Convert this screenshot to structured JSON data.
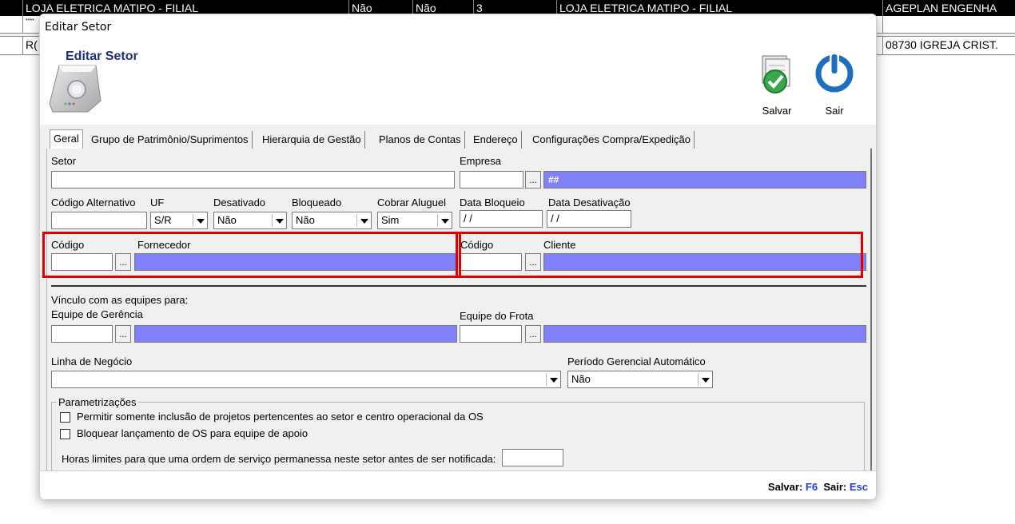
{
  "background": {
    "row0": [
      "LOJA ELETRICA MATIPO - FILIAL",
      "Não",
      "Não",
      "3",
      "LOJA ELETRICA MATIPO - FILIAL",
      "AGEPLAN ENGENHA"
    ],
    "row1_marker": "****",
    "row2": [
      "R(",
      "08730 IGREJA CRIST."
    ]
  },
  "window": {
    "title": "Editar Setor"
  },
  "header": {
    "title": "Editar Setor",
    "save_label": "Salvar",
    "exit_label": "Sair"
  },
  "tabs": [
    {
      "label": "Geral"
    },
    {
      "label": "Grupo de Patrimônio/Suprimentos"
    },
    {
      "label": "Hierarquia de Gestão"
    },
    {
      "label": "Planos de Contas"
    },
    {
      "label": "Endereço"
    },
    {
      "label": "Configurações Compra/Expedição"
    }
  ],
  "form": {
    "setor_label": "Setor",
    "setor_value": "",
    "empresa_label": "Empresa",
    "empresa_code": "",
    "empresa_name": "##",
    "codigo_alt_label": "Código Alternativo",
    "uf_label": "UF",
    "uf_value": "S/R",
    "desativado_label": "Desativado",
    "desativado_value": "Não",
    "bloqueado_label": "Bloqueado",
    "bloqueado_value": "Não",
    "cobrar_label": "Cobrar Aluguel",
    "cobrar_value": "Sim",
    "data_bloq_label": "Data Bloqueio",
    "data_bloq_value": "/ /",
    "data_desat_label": "Data Desativação",
    "data_desat_value": "/ /",
    "codigo_label": "Código",
    "fornecedor_label": "Fornecedor",
    "codigo2_label": "Código",
    "cliente_label": "Cliente",
    "vinculo_label": "Vínculo com as equipes para:",
    "equipe_ger_label": "Equipe de Gerência",
    "equipe_frota_label": "Equipe do Frota",
    "linha_label": "Linha de Negócio",
    "linha_value": "",
    "periodo_label": "Período Gerencial Automático",
    "periodo_value": "Não",
    "param_label": "Parametrizações",
    "chk1_label": "Permitir somente inclusão de projetos pertencentes ao setor e centro operacional da OS",
    "chk2_label": "Bloquear lançamento de OS para equipe de apoio",
    "horas_label": "Horas limites para que uma ordem de serviço permanessa neste setor antes de ser notificada:",
    "horas_value": ""
  },
  "footer": {
    "save_text": "Salvar:",
    "save_key": "F6",
    "exit_text": "Sair:",
    "exit_key": "Esc"
  },
  "colors": {
    "lookup_blue": "#8080f8",
    "highlight_red": "#e00000",
    "title_blue": "#1f2f7a",
    "key_blue": "#2040d0"
  }
}
